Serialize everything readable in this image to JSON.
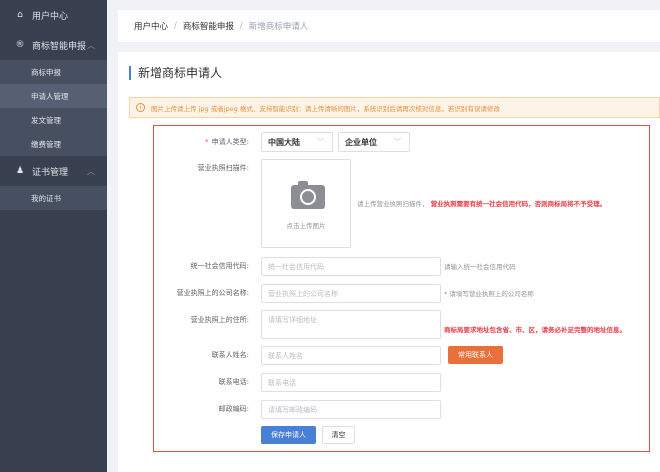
{
  "sidebar": {
    "user_center": "用户中心",
    "trademark": "商标智能申报",
    "trademark_items": [
      "商标申报",
      "申请人管理",
      "发文管理",
      "缴费管理"
    ],
    "certificate": "证书管理",
    "certificate_items": [
      "我的证书"
    ],
    "active": "申请人管理"
  },
  "breadcrumb": [
    "用户中心",
    "商标智能申报",
    "新增商标申请人"
  ],
  "page_title": "新增商标申请人",
  "alert": "图片上传请上传 jpg 或者jpeg 格式、支持智能识别：请上传清晰的图片，系统识别后请再次核对信息，若识别有误请修改",
  "form": {
    "type_label": "申请人类型:",
    "region": "中国大陆",
    "entity": "企业单位",
    "license_label": "营业执照扫描件:",
    "upload_text": "点击上传图片",
    "license_hint": "请上传营业执照扫描件，",
    "license_warn": "营业执照需要有统一社会信用代码，否则商标局将不予受理。",
    "credit_label": "统一社会信用代码:",
    "credit_placeholder": "统一社会信用代码",
    "credit_hint": "请输入统一社会信用代码",
    "company_label": "营业执照上的公司名称:",
    "company_placeholder": "营业执照上的公司名称",
    "company_hint": "* 请填写营业执照上的公司名称",
    "address_label": "营业执照上的住所:",
    "address_placeholder": "请填写详细地址",
    "address_warn": "商标局要求地址包含省、市、区，请务必补足完整的地址信息。",
    "contact_label": "联系人姓名:",
    "contact_placeholder": "联系人姓名",
    "common_contact": "常用联系人",
    "phone_label": "联系电话:",
    "phone_placeholder": "联系电话",
    "postal_label": "邮政编码:",
    "postal_placeholder": "请填写邮政编码",
    "save": "保存申请人",
    "clear": "清空"
  },
  "colors": {
    "accent": "#4a7fd6",
    "danger": "#e8503a",
    "orange": "#e8703a",
    "sidebar": "#394150"
  }
}
